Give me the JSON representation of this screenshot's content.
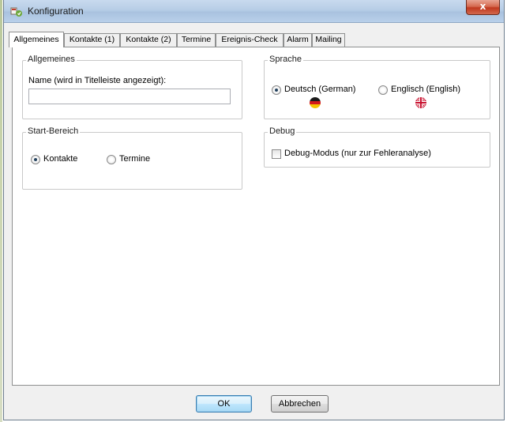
{
  "window": {
    "title": "Konfiguration",
    "close_glyph": "x"
  },
  "tabs": [
    {
      "label": "Allgemeines",
      "active": true
    },
    {
      "label": "Kontakte (1)"
    },
    {
      "label": "Kontakte (2)"
    },
    {
      "label": "Termine"
    },
    {
      "label": "Ereignis-Check"
    },
    {
      "label": "Alarm"
    },
    {
      "label": "Mailing"
    }
  ],
  "general": {
    "legend": "Allgemeines",
    "name_label": "Name (wird in Titelleiste angezeigt):",
    "name_value": ""
  },
  "start": {
    "legend": "Start-Bereich",
    "options": [
      {
        "label": "Kontakte",
        "checked": true
      },
      {
        "label": "Termine",
        "checked": false
      }
    ]
  },
  "language": {
    "legend": "Sprache",
    "options": [
      {
        "label": "Deutsch (German)",
        "checked": true,
        "flag_icon": "germany-flag-icon"
      },
      {
        "label": "Englisch (English)",
        "checked": false,
        "flag_icon": "uk-flag-icon"
      }
    ]
  },
  "debug": {
    "legend": "Debug",
    "checkbox_label": "Debug-Modus (nur zur Fehleranalyse)",
    "checked": false
  },
  "buttons": {
    "ok": "OK",
    "cancel": "Abbrechen"
  },
  "colors": {
    "title_bar": "#b7cde6",
    "close_button": "#c0391f",
    "default_button": "#bee6fd"
  }
}
